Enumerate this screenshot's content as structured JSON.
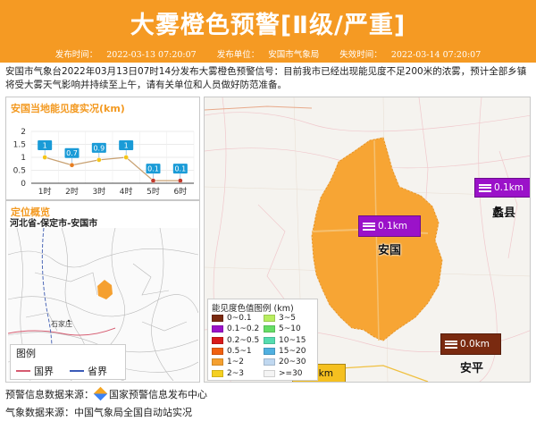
{
  "header": {
    "title": "大雾橙色预警[Ⅱ级/严重]",
    "publish_time_label": "发布时间：",
    "publish_time": "2022-03-13 07:20:07",
    "publish_unit_label": "发布单位：",
    "publish_unit": "安国市气象局",
    "expire_label": "失效时间：",
    "expire_time": "2022-03-14 07:20:07",
    "color": "#f59a23"
  },
  "description": "安国市气象台2022年03月13日07时14分发布大雾橙色预警信号：目前我市已经出现能见度不足200米的浓雾，预计全部乡镇将受大雾天气影响并持续至上午，请有关单位和人员做好防范准备。",
  "chart_panel": {
    "title": "安国当地能见度实况(km)"
  },
  "chart_data": {
    "type": "line",
    "title": "安国当地能见度实况(km)",
    "categories": [
      "1时",
      "2时",
      "3时",
      "4时",
      "5时",
      "6时"
    ],
    "values": [
      1,
      0.7,
      0.9,
      1,
      0.1,
      0.1
    ],
    "value_labels": [
      "1",
      "0.7",
      "0.9",
      "1",
      "0.1",
      "0.1"
    ],
    "ylim": [
      0,
      2
    ],
    "yticks": [
      "0",
      "0.5",
      "1",
      "1.5",
      "2"
    ],
    "grid": true,
    "label_color": "#1a9bd7",
    "line_color": "#c8a070"
  },
  "overview": {
    "title": "定位概览",
    "region_path": "河北省-保定市-安国市",
    "legend_title": "图例",
    "legend_county": "国界",
    "legend_province": "省界",
    "city_label": "石家庄"
  },
  "map": {
    "legend_title": "能见度色值图例 (km)",
    "legend_items": [
      {
        "label": "0~0.1",
        "color": "#7a2a10"
      },
      {
        "label": "0.1~0.2",
        "color": "#9b12c9"
      },
      {
        "label": "0.2~0.5",
        "color": "#d81a1a"
      },
      {
        "label": "0.5~1",
        "color": "#f06010"
      },
      {
        "label": "1~2",
        "color": "#f5a030"
      },
      {
        "label": "2~3",
        "color": "#f5d020"
      },
      {
        "label": "3~5",
        "color": "#b8ee60"
      },
      {
        "label": "5~10",
        "color": "#66dd66"
      },
      {
        "label": "10~15",
        "color": "#55dcb0"
      },
      {
        "label": "15~20",
        "color": "#50b0e0"
      },
      {
        "label": "20~30",
        "color": "#c0d8f0"
      },
      {
        "label": ">=30",
        "color": "#f4f4f4"
      }
    ],
    "stations": [
      {
        "name": "安国",
        "value": "0.1km",
        "color": "#9b12c9"
      },
      {
        "name": "蠡县",
        "value": "0.1km",
        "color": "#9b12c9"
      },
      {
        "name": "安平",
        "value": "0.0km",
        "color": "#7a2a10"
      }
    ],
    "partial_label": "9km"
  },
  "footer": {
    "source1_label": "预警信息数据来源：",
    "source1": "国家预警信息发布中心",
    "source2_label": "气象数据来源：",
    "source2": "中国气象局全国自动站实况"
  }
}
